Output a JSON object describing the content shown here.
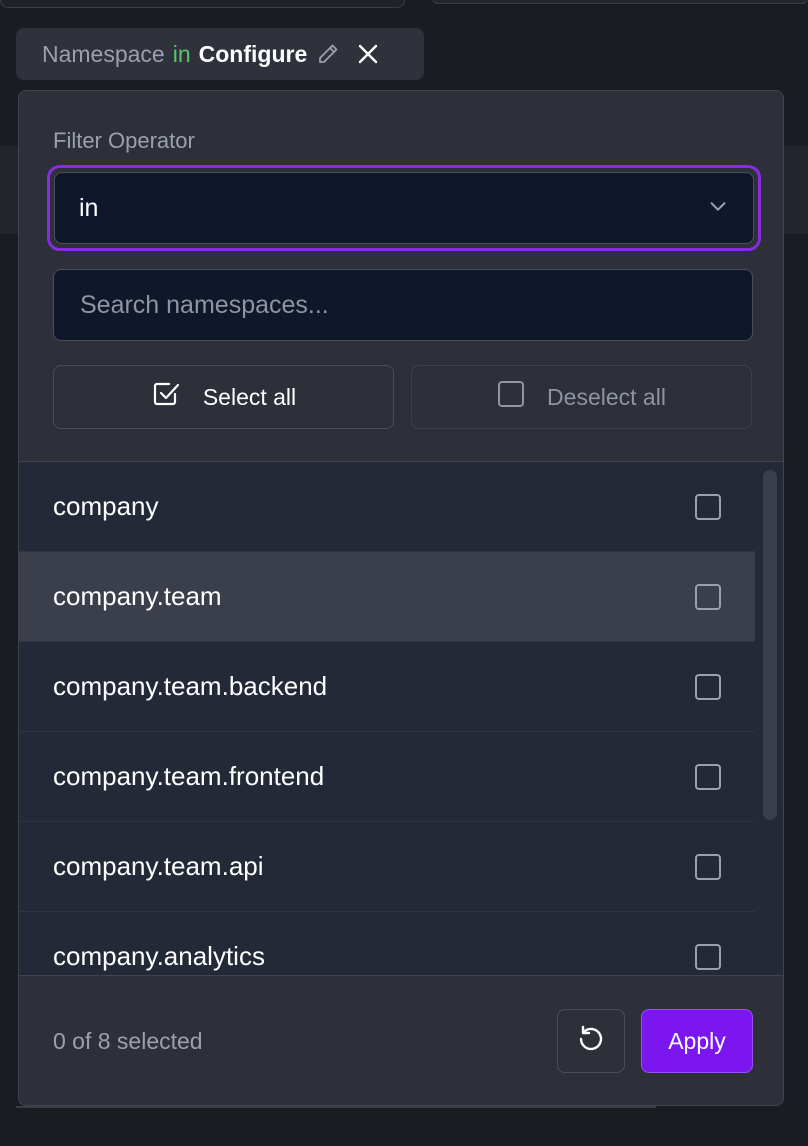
{
  "chip": {
    "field": "Namespace",
    "operator": "in",
    "value": "Configure",
    "icons": [
      "pencil-icon",
      "close-icon"
    ]
  },
  "popover": {
    "filter_label": "Filter Operator",
    "operator_value": "in",
    "search_placeholder": "Search namespaces...",
    "select_all_label": "Select all",
    "deselect_all_label": "Deselect all",
    "items": [
      "company",
      "company.team",
      "company.team.backend",
      "company.team.frontend",
      "company.team.api",
      "company.analytics"
    ],
    "hovered_item": "company.team",
    "selection_count": "0 of 8 selected",
    "apply_label": "Apply"
  },
  "colors": {
    "accent": "#7b17ee",
    "focus_ring": "#8a2be2",
    "operator_green": "#5ec36a",
    "panel": "#2d2f39",
    "input_bg": "#10172a"
  }
}
